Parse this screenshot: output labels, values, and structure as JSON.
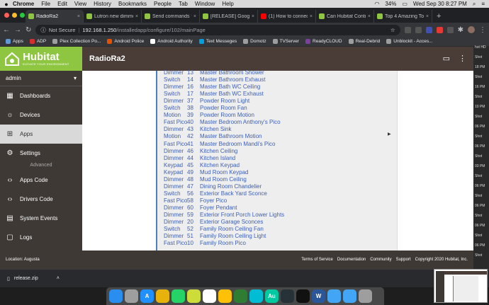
{
  "menubar": {
    "items": [
      "Chrome",
      "File",
      "Edit",
      "View",
      "History",
      "Bookmarks",
      "People",
      "Tab",
      "Window",
      "Help"
    ],
    "battery": "34%",
    "clock": "Wed Sep 30  8:27 PM"
  },
  "tabs": [
    {
      "label": "RadioRa2",
      "color": "#8ec641"
    },
    {
      "label": "Lutron new dimmer",
      "color": "#8ec641"
    },
    {
      "label": "Send commands to",
      "color": "#8ec641"
    },
    {
      "label": "[RELEASE] Google",
      "color": "#8ec641"
    },
    {
      "label": "(1) How to connect",
      "color": "#ff0000"
    },
    {
      "label": "Can Hubitat Contro",
      "color": "#8ec641"
    },
    {
      "label": "Top 4 Amazing Too",
      "color": "#8ec641"
    }
  ],
  "address": {
    "security": "Not Secure",
    "host": "192.168.1.250",
    "path": "/installedapp/configure/102/mainPage"
  },
  "bookmarks": [
    {
      "label": "Apps",
      "color": "#5f9ad6"
    },
    {
      "label": "ADP",
      "color": "#d32f2f"
    },
    {
      "label": "Plex Collection Po...",
      "color": "#9e9e9e"
    },
    {
      "label": "Android Police",
      "color": "#e65100"
    },
    {
      "label": "Android Authority",
      "color": "#ffffff"
    },
    {
      "label": "Text Messeges",
      "color": "#00a0e0"
    },
    {
      "label": "Domotz",
      "color": "#9e9e9e"
    },
    {
      "label": "TVServer",
      "color": "#9e9e9e"
    },
    {
      "label": "ReadyCLOUD",
      "color": "#7b3fa0"
    },
    {
      "label": "Real-Debrid",
      "color": "#9e9e9e"
    },
    {
      "label": "Unblockit - Acces...",
      "color": "#9e9e9e"
    }
  ],
  "hub": {
    "logo_name": "Hubitat",
    "logo_tagline": "ELEVATE YOUR ENVIRONMENT",
    "page_title": "RadioRa2",
    "hub_select": "admin",
    "nav": [
      {
        "label": "Dashboards",
        "icon": "dashboard-icon",
        "glyph": "▦",
        "active": false
      },
      {
        "label": "Devices",
        "icon": "lightbulb-icon",
        "glyph": "☼",
        "active": false
      },
      {
        "label": "Apps",
        "icon": "apps-icon",
        "glyph": "⊞",
        "active": true
      },
      {
        "label": "Settings",
        "icon": "sliders-icon",
        "glyph": "⚙",
        "active": false
      }
    ],
    "advanced_label": "Advanced",
    "nav_advanced": [
      {
        "label": "Apps Code",
        "icon": "code-icon",
        "glyph": "‹›"
      },
      {
        "label": "Drivers Code",
        "icon": "code-icon",
        "glyph": "‹›"
      },
      {
        "label": "System Events",
        "icon": "events-icon",
        "glyph": "▤"
      },
      {
        "label": "Logs",
        "icon": "logs-icon",
        "glyph": "▢"
      }
    ],
    "footer_location": "Location: Augusta",
    "footer_links": [
      "Terms of Service",
      "Documentation",
      "Community",
      "Support",
      "Copyright 2020 Hubitat, Inc."
    ]
  },
  "devices": [
    {
      "type": "Dimmer",
      "id": "13",
      "name": "Master Bathroom Shower"
    },
    {
      "type": "Switch",
      "id": "14",
      "name": "Master Bathroom Exhaust"
    },
    {
      "type": "Dimmer",
      "id": "16",
      "name": "Master Bath WC Ceiling"
    },
    {
      "type": "Switch",
      "id": "17",
      "name": "Master Bath WC Exhaust"
    },
    {
      "type": "Dimmer",
      "id": "37",
      "name": "Powder Room Light"
    },
    {
      "type": "Switch",
      "id": "38",
      "name": "Powder Room Fan"
    },
    {
      "type": "Motion",
      "id": "39",
      "name": "Powder Room Motion"
    },
    {
      "type": "Fast Pico",
      "id": "40",
      "name": "Master Bedroom Anthony's Pico"
    },
    {
      "type": "Dimmer",
      "id": "43",
      "name": "Kitchen Sink"
    },
    {
      "type": "Motion",
      "id": "42",
      "name": "Master Bathroom Motion"
    },
    {
      "type": "Fast Pico",
      "id": "41",
      "name": "Master Bedroom Mandi's Pico"
    },
    {
      "type": "Dimmer",
      "id": "46",
      "name": "Kitchen Ceiling"
    },
    {
      "type": "Dimmer",
      "id": "44",
      "name": "Kitchen Island"
    },
    {
      "type": "Keypad",
      "id": "45",
      "name": "Kitchen Keypad"
    },
    {
      "type": "Keypad",
      "id": "49",
      "name": "Mud Room Keypad"
    },
    {
      "type": "Dimmer",
      "id": "48",
      "name": "Mud Room Ceiling"
    },
    {
      "type": "Dimmer",
      "id": "47",
      "name": "Dining Room Chandelier"
    },
    {
      "type": "Switch",
      "id": "56",
      "name": "Exterior Back Yard Sconce"
    },
    {
      "type": "Fast Pico",
      "id": "58",
      "name": "Foyer Pico"
    },
    {
      "type": "Dimmer",
      "id": "60",
      "name": "Foyer Pendant"
    },
    {
      "type": "Dimmer",
      "id": "59",
      "name": "Exterior Front Porch Lower Lights"
    },
    {
      "type": "Dimmer",
      "id": "20",
      "name": "Exterior Garage Sconces"
    },
    {
      "type": "Switch",
      "id": "52",
      "name": "Family Room Ceiling Fan"
    },
    {
      "type": "Dimmer",
      "id": "51",
      "name": "Family Room Ceiling Light"
    },
    {
      "type": "Fast Pico",
      "id": "10",
      "name": "Family Room Pico"
    }
  ],
  "download": {
    "filename": "release.zip"
  },
  "rightstrip": [
    "hot HD",
    "Shot",
    "18 PM",
    "Shot",
    "16 PM",
    "Shot",
    "10 PM",
    "Shot",
    "06 PM",
    "Shot",
    "06 PM",
    "Shot",
    "03 PM",
    "Shot",
    "06 PM",
    "Shot",
    "06 PM",
    "Shot",
    "06 PM",
    "Shot",
    "06 PM",
    "Shot"
  ],
  "dock": [
    {
      "icon": "finder-icon",
      "color": "#2a8df0",
      "glyph": ""
    },
    {
      "icon": "launchpad-icon",
      "color": "#9e9e9e",
      "glyph": ""
    },
    {
      "icon": "appstore-icon",
      "color": "#1e90ff",
      "glyph": "A"
    },
    {
      "icon": "chrome-icon",
      "color": "#e8b20c",
      "glyph": ""
    },
    {
      "icon": "whatsapp-icon",
      "color": "#25d366",
      "glyph": ""
    },
    {
      "icon": "app-icon",
      "color": "#cddc39",
      "glyph": ""
    },
    {
      "icon": "calendar-icon",
      "color": "#ffffff",
      "glyph": ""
    },
    {
      "icon": "tips-icon",
      "color": "#ffc107",
      "glyph": ""
    },
    {
      "icon": "notes-icon",
      "color": "#2e7d32",
      "glyph": ""
    },
    {
      "icon": "app-icon",
      "color": "#00bcd4",
      "glyph": ""
    },
    {
      "icon": "audition-icon",
      "color": "#00c8a0",
      "glyph": "Au"
    },
    {
      "icon": "app-icon",
      "color": "#263238",
      "glyph": ""
    },
    {
      "icon": "terminal-icon",
      "color": "#111111",
      "glyph": ""
    },
    {
      "icon": "word-icon",
      "color": "#2b579a",
      "glyph": "W"
    },
    {
      "icon": "folder-icon",
      "color": "#42a5f5",
      "glyph": ""
    },
    {
      "icon": "folder-icon",
      "color": "#42a5f5",
      "glyph": ""
    },
    {
      "icon": "trash-icon",
      "color": "#9e9e9e",
      "glyph": ""
    }
  ]
}
